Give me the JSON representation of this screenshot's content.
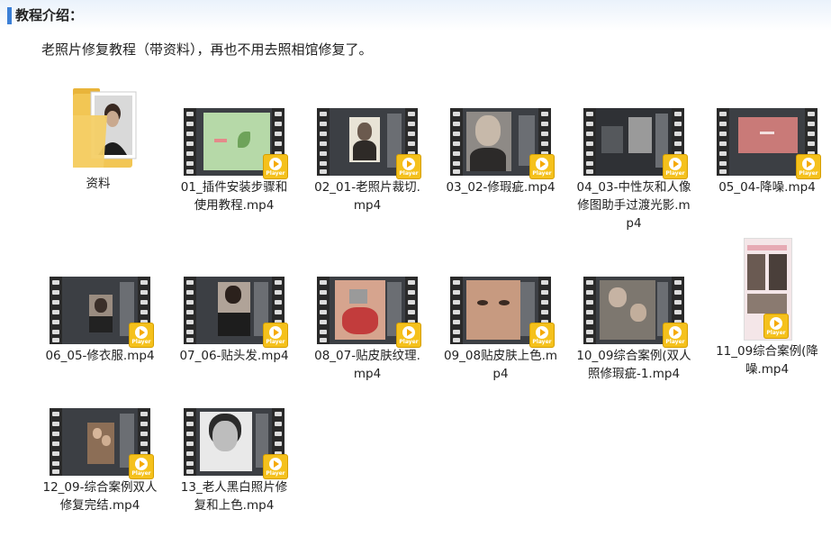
{
  "header": {
    "title": "教程介绍："
  },
  "intro": {
    "text": "老照片修复教程（带资料），再也不用去照相馆修复了。"
  },
  "badge": {
    "text": "Player"
  },
  "files": [
    {
      "name": "资料",
      "type": "folder"
    },
    {
      "name": "01_插件安装步骤和使用教程.mp4",
      "type": "video"
    },
    {
      "name": "02_01-老照片裁切.mp4",
      "type": "video"
    },
    {
      "name": "03_02-修瑕疵.mp4",
      "type": "video"
    },
    {
      "name": "04_03-中性灰和人像修图助手过渡光影.mp4",
      "type": "video"
    },
    {
      "name": "05_04-降噪.mp4",
      "type": "video"
    },
    {
      "name": "06_05-修衣服.mp4",
      "type": "video"
    },
    {
      "name": "07_06-贴头发.mp4",
      "type": "video"
    },
    {
      "name": "08_07-贴皮肤纹理.mp4",
      "type": "video"
    },
    {
      "name": "09_08贴皮肤上色.mp4",
      "type": "video"
    },
    {
      "name": "10_09综合案例(双人照修瑕疵-1.mp4",
      "type": "video"
    },
    {
      "name": "11_09综合案例(降噪.mp4",
      "type": "video"
    },
    {
      "name": "12_09-综合案例双人修复完结.mp4",
      "type": "video"
    },
    {
      "name": "13_老人黑白照片修复和上色.mp4",
      "type": "video"
    }
  ]
}
